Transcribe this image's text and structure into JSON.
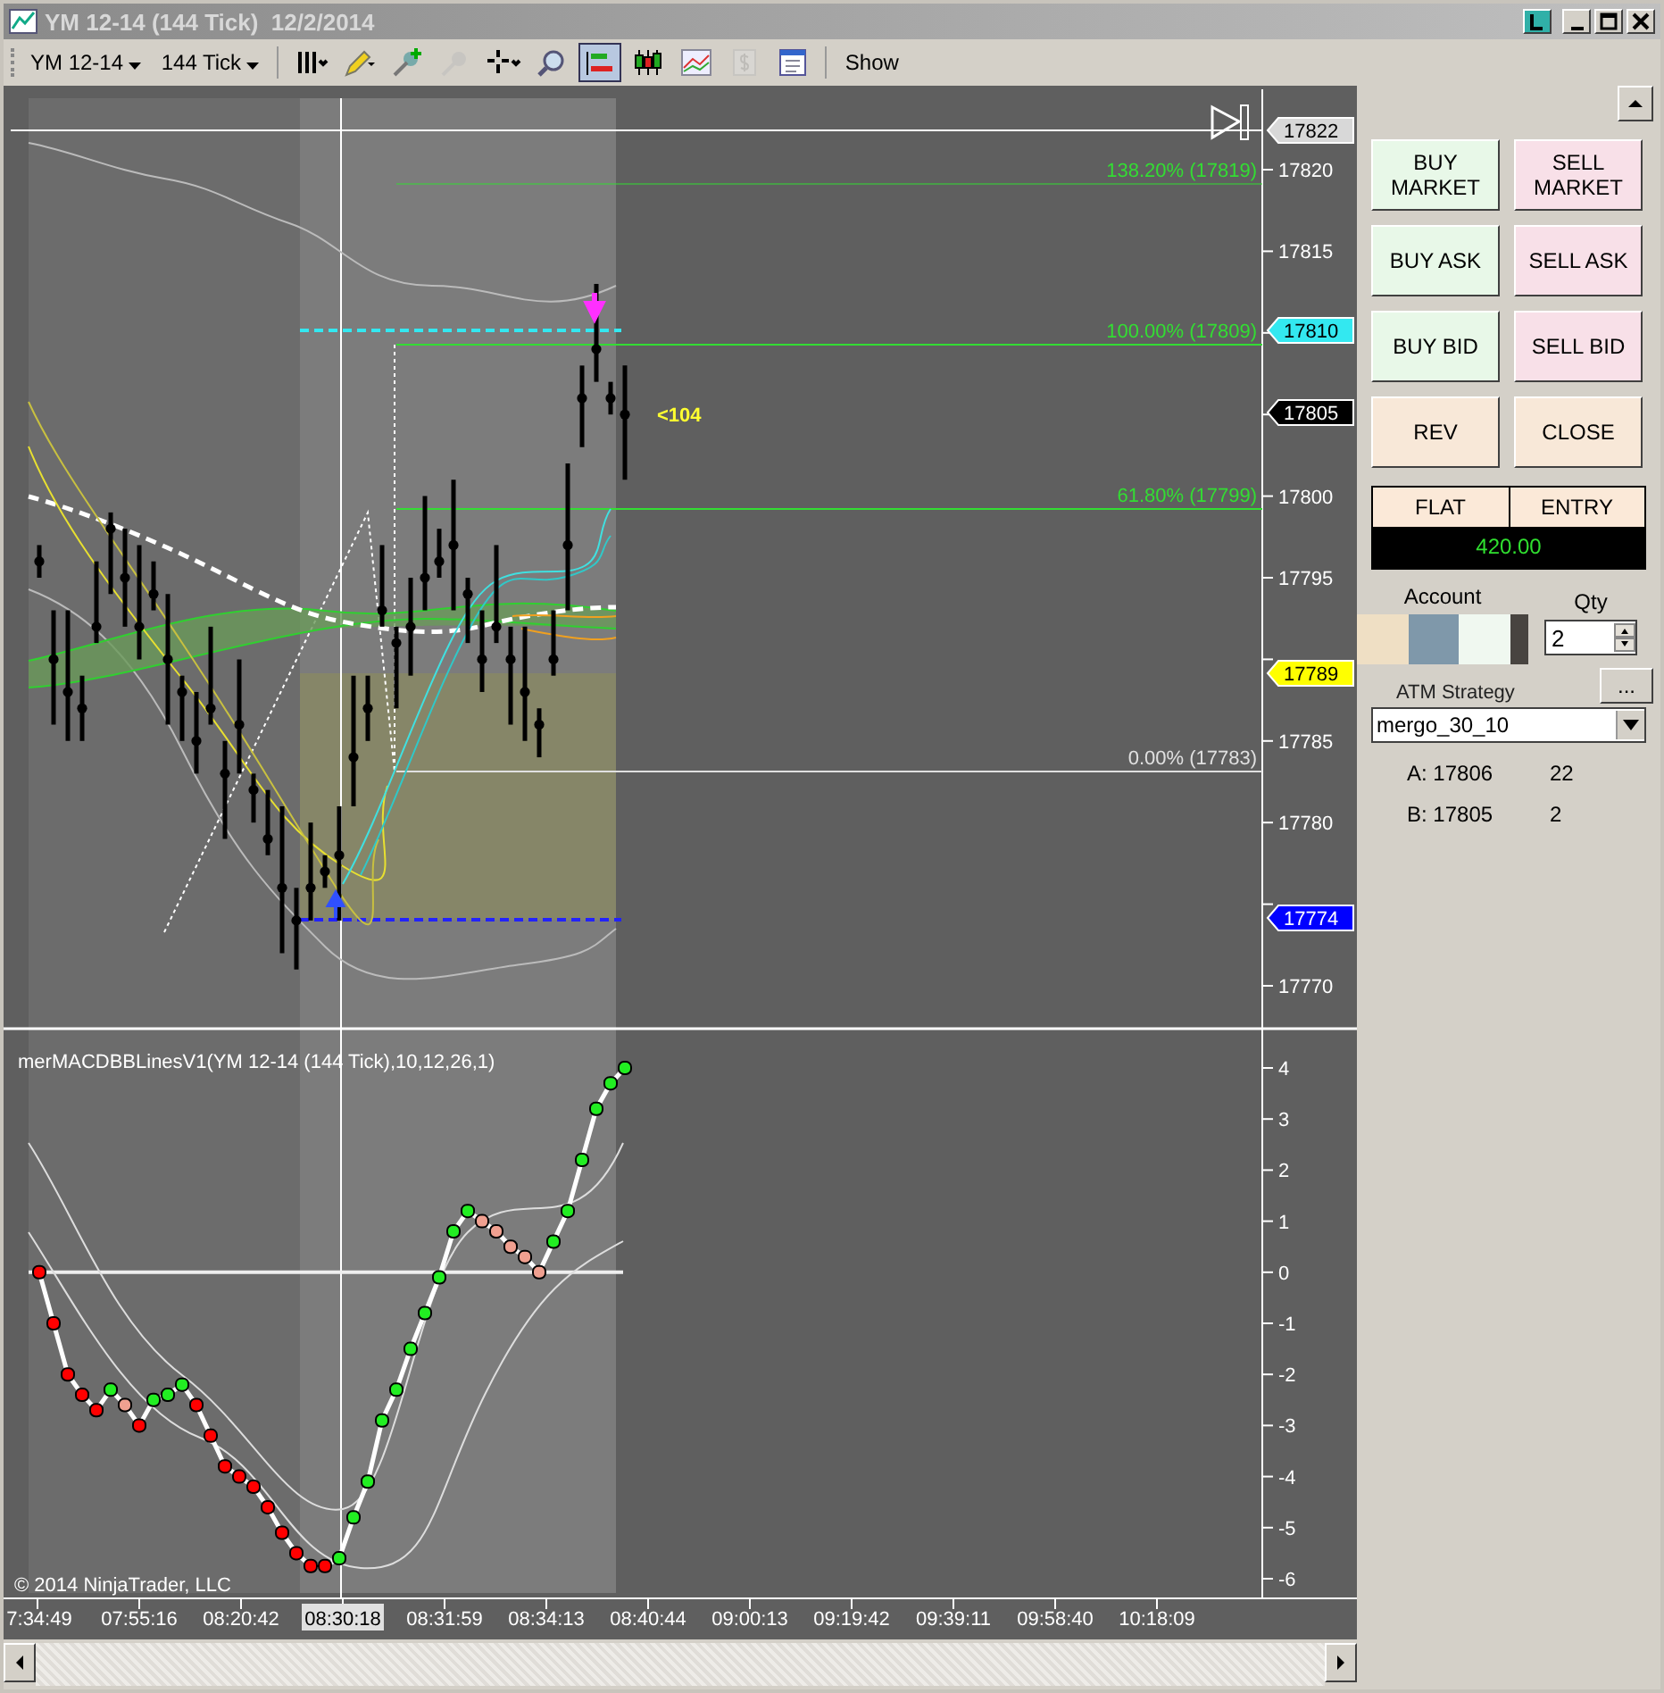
{
  "window": {
    "title": "YM 12-14 (144 Tick)  12/2/2014"
  },
  "toolbar": {
    "instrument": "YM 12-14",
    "interval": "144 Tick",
    "show_label": "Show",
    "tools": [
      {
        "kind": "bar-style",
        "selected": false,
        "disabled": false
      },
      {
        "kind": "pencil",
        "selected": false,
        "disabled": false
      },
      {
        "kind": "pin-add",
        "selected": false,
        "disabled": false
      },
      {
        "kind": "pin",
        "selected": false,
        "disabled": true
      },
      {
        "kind": "crosshair",
        "selected": false,
        "disabled": false
      },
      {
        "kind": "zoom",
        "selected": false,
        "disabled": false
      },
      {
        "kind": "chart-trader",
        "selected": true,
        "disabled": false
      },
      {
        "kind": "candles",
        "selected": false,
        "disabled": false
      },
      {
        "kind": "indicators",
        "selected": false,
        "disabled": false
      },
      {
        "kind": "dollar",
        "selected": false,
        "disabled": true
      },
      {
        "kind": "properties",
        "selected": false,
        "disabled": false
      }
    ]
  },
  "price_chart": {
    "axis_labels": [
      "17820",
      "17815",
      "17800",
      "17795",
      "17785",
      "17780",
      "17770"
    ],
    "tags": [
      {
        "price": "17822",
        "color": "#d8d8d8"
      },
      {
        "price": "17810",
        "color": "#33e8f0"
      },
      {
        "price": "17805",
        "color": "#000000"
      },
      {
        "price": "17789",
        "color": "#ffff00"
      },
      {
        "price": "17774",
        "color": "#0000ff"
      }
    ],
    "fib_levels": [
      {
        "label": "138.20% (17819)",
        "color": "#33dd33"
      },
      {
        "label": "100.00% (17809)",
        "color": "#33dd33"
      },
      {
        "label": "61.80% (17799)",
        "color": "#33dd33"
      },
      {
        "label": "0.00% (17783)",
        "color": "#e0e0e0"
      }
    ],
    "note": "<104"
  },
  "indicator": {
    "title": "merMACDBBLinesV1(YM 12-14 (144 Tick),10,12,26,1)",
    "axis_labels": [
      "4",
      "3",
      "2",
      "1",
      "0",
      "-1",
      "-2",
      "-3",
      "-4",
      "-5",
      "-6"
    ],
    "copyright": "© 2014 NinjaTrader, LLC"
  },
  "time_axis": [
    {
      "label": "7:34:49",
      "selected": false
    },
    {
      "label": "07:55:16",
      "selected": false
    },
    {
      "label": "08:20:42",
      "selected": false
    },
    {
      "label": "08:30:18",
      "selected": true
    },
    {
      "label": "08:31:59",
      "selected": false
    },
    {
      "label": "08:34:13",
      "selected": false
    },
    {
      "label": "08:40:44",
      "selected": false
    },
    {
      "label": "09:00:13",
      "selected": false
    },
    {
      "label": "09:19:42",
      "selected": false
    },
    {
      "label": "09:39:11",
      "selected": false
    },
    {
      "label": "09:58:40",
      "selected": false
    },
    {
      "label": "10:18:09",
      "selected": false
    }
  ],
  "order_buttons": [
    {
      "label": "BUY MARKET",
      "kind": "buy"
    },
    {
      "label": "SELL MARKET",
      "kind": "sell"
    },
    {
      "label": "BUY ASK",
      "kind": "buy"
    },
    {
      "label": "SELL ASK",
      "kind": "sell"
    },
    {
      "label": "BUY BID",
      "kind": "buy"
    },
    {
      "label": "SELL BID",
      "kind": "sell"
    },
    {
      "label": "REV",
      "kind": "neutral"
    },
    {
      "label": "CLOSE",
      "kind": "neutral"
    }
  ],
  "position": {
    "status": "FLAT",
    "entry_label": "ENTRY",
    "pnl": "420.00"
  },
  "account": {
    "label": "Account",
    "swatches": [
      {
        "color": "#efdfc4"
      },
      {
        "color": "#7f98aa"
      },
      {
        "color": "#f0f8f0"
      },
      {
        "color": "#484440"
      }
    ]
  },
  "qty": {
    "label": "Qty",
    "value": "2"
  },
  "atm": {
    "label": "ATM Strategy",
    "button": "...",
    "value": "mergo_30_10"
  },
  "quotes": [
    {
      "label": "A: 17806",
      "size": "22"
    },
    {
      "label": "B: 17805",
      "size": "2"
    }
  ]
}
